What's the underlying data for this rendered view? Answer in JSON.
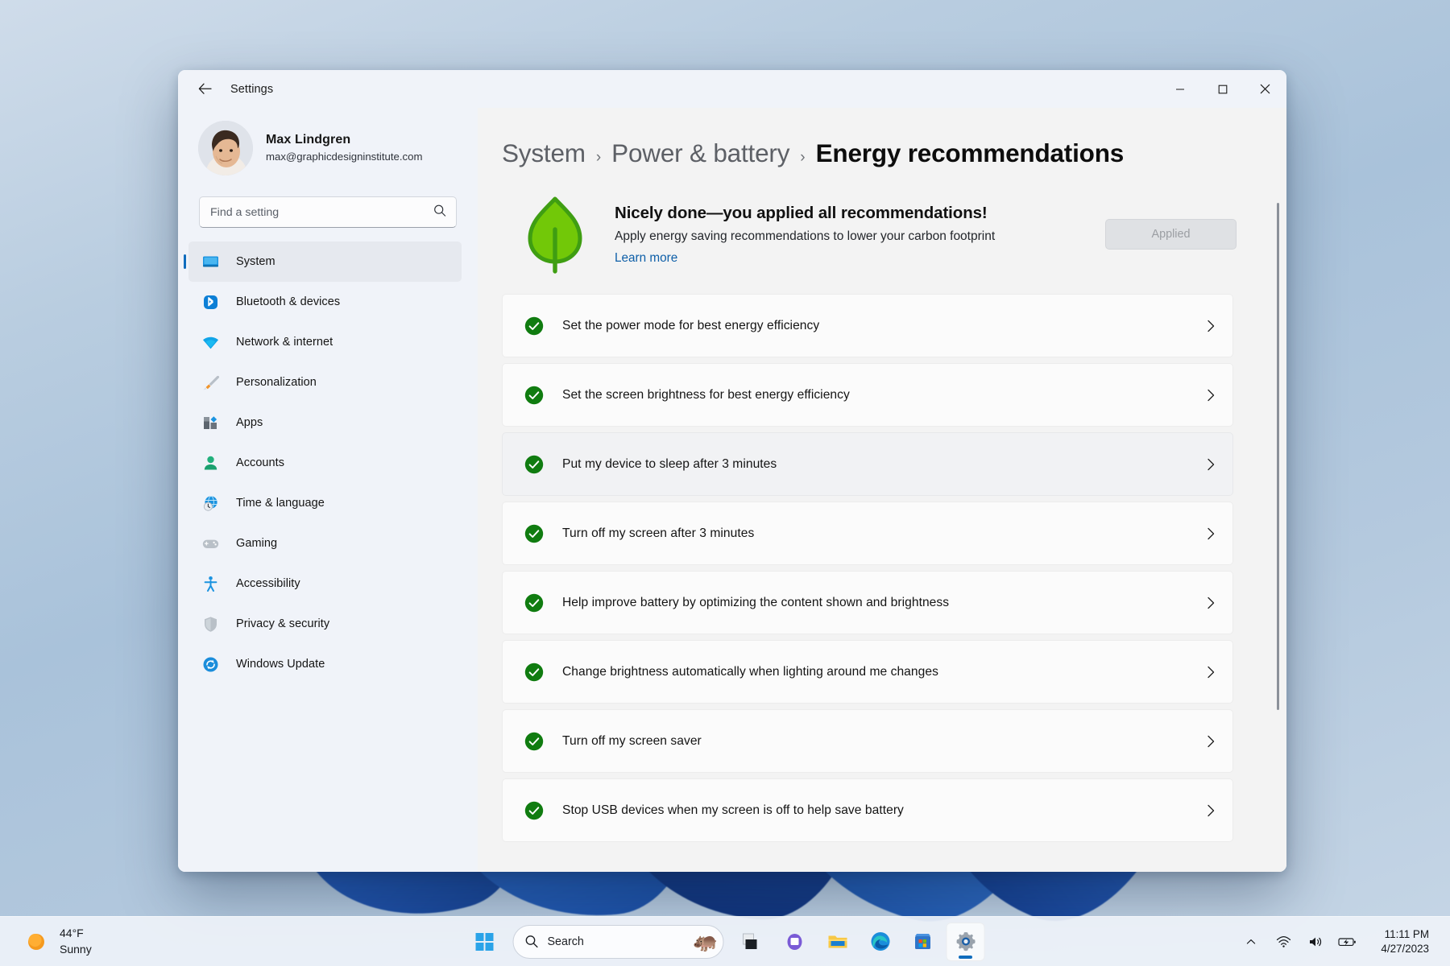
{
  "window": {
    "title": "Settings",
    "back_icon": "back-arrow-icon",
    "minimize_label": "Minimize",
    "maximize_label": "Maximize",
    "close_label": "Close"
  },
  "account": {
    "name": "Max Lindgren",
    "email": "max@graphicdesigninstitute.com",
    "avatar_name": "user-avatar"
  },
  "search": {
    "placeholder": "Find a setting",
    "value": "",
    "icon": "search-icon"
  },
  "sidebar": {
    "items": [
      {
        "label": "System",
        "icon": "monitor-icon",
        "active": true
      },
      {
        "label": "Bluetooth & devices",
        "icon": "bluetooth-icon",
        "active": false
      },
      {
        "label": "Network & internet",
        "icon": "wifi-icon",
        "active": false
      },
      {
        "label": "Personalization",
        "icon": "paintbrush-icon",
        "active": false
      },
      {
        "label": "Apps",
        "icon": "apps-grid-icon",
        "active": false
      },
      {
        "label": "Accounts",
        "icon": "person-icon",
        "active": false
      },
      {
        "label": "Time & language",
        "icon": "clock-globe-icon",
        "active": false
      },
      {
        "label": "Gaming",
        "icon": "gamepad-icon",
        "active": false
      },
      {
        "label": "Accessibility",
        "icon": "accessibility-person-icon",
        "active": false
      },
      {
        "label": "Privacy & security",
        "icon": "shield-icon",
        "active": false
      },
      {
        "label": "Windows Update",
        "icon": "update-refresh-icon",
        "active": false
      }
    ]
  },
  "breadcrumb": {
    "parent": "System",
    "middle": "Power & battery",
    "current": "Energy recommendations",
    "separator": "›"
  },
  "hero": {
    "icon": "green-leaf-icon",
    "title": "Nicely done—you applied all recommendations!",
    "subtitle": "Apply energy saving recommendations to lower your carbon footprint",
    "link": "Learn more",
    "button_label": "Applied",
    "button_disabled": true,
    "accent_green": "#6dbf1a",
    "accent_blue": "#0e5fa8"
  },
  "recommendations": {
    "check_icon": "green-check-circle-icon",
    "chevron_icon": "chevron-right-icon",
    "items": [
      {
        "label": "Set the power mode for best energy efficiency",
        "applied": true,
        "hover": false
      },
      {
        "label": "Set the screen brightness for best energy efficiency",
        "applied": true,
        "hover": false
      },
      {
        "label": "Put my device to sleep after 3 minutes",
        "applied": true,
        "hover": true
      },
      {
        "label": "Turn off my screen after 3 minutes",
        "applied": true,
        "hover": false
      },
      {
        "label": "Help improve battery by optimizing the content shown and brightness",
        "applied": true,
        "hover": false
      },
      {
        "label": "Change brightness automatically when lighting around me changes",
        "applied": true,
        "hover": false
      },
      {
        "label": "Turn off my screen saver",
        "applied": true,
        "hover": false
      },
      {
        "label": "Stop USB devices when my screen is off to help save battery",
        "applied": true,
        "hover": false
      }
    ]
  },
  "taskbar": {
    "weather": {
      "temperature": "44°F",
      "condition": "Sunny",
      "icon": "sun-icon"
    },
    "start_label": "Start",
    "search": {
      "placeholder": "Search",
      "icon": "search-icon",
      "decoration": "hippo-icon"
    },
    "apps": [
      {
        "name": "task-view-icon",
        "label": "Task view",
        "active": false
      },
      {
        "name": "chat-teams-icon",
        "label": "Chat",
        "active": false
      },
      {
        "name": "file-explorer-icon",
        "label": "File Explorer",
        "active": false
      },
      {
        "name": "edge-browser-icon",
        "label": "Microsoft Edge",
        "active": false
      },
      {
        "name": "microsoft-store-icon",
        "label": "Microsoft Store",
        "active": false
      },
      {
        "name": "settings-gear-icon",
        "label": "Settings",
        "active": true
      }
    ],
    "tray": {
      "chevron": "chevron-up-icon",
      "wifi": "wifi-icon",
      "volume": "speaker-icon",
      "battery": "battery-charging-icon",
      "time": "11:11 PM",
      "date": "4/27/2023"
    }
  }
}
